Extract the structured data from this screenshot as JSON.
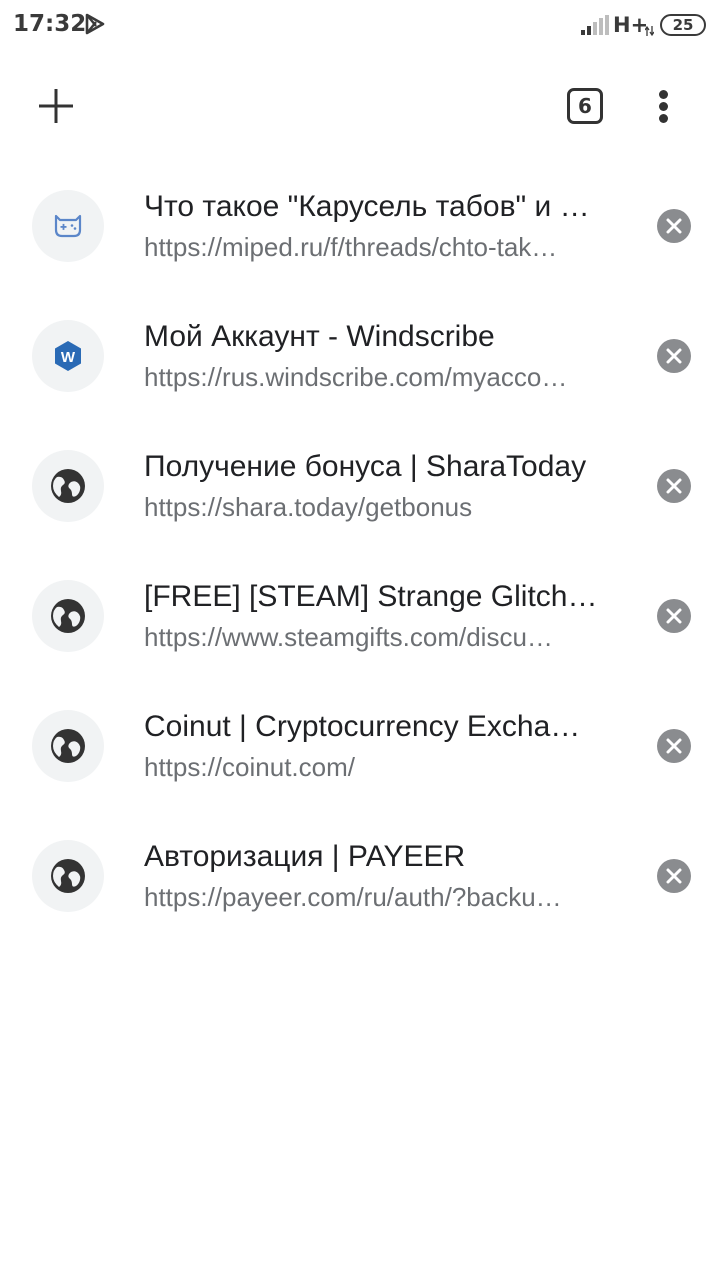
{
  "status_bar": {
    "time": "17:32",
    "app_icon": "play-store-icon",
    "network": "H+",
    "battery": "25"
  },
  "toolbar": {
    "new_tab_icon": "plus-icon",
    "tab_count": "6",
    "menu_icon": "more-vert-icon"
  },
  "tabs": [
    {
      "title": "Что такое \"Карусель табов\" и …",
      "url": "https://miped.ru/f/threads/chto-tak…",
      "favicon": "gamepad-icon"
    },
    {
      "title": "Мой Аккаунт - Windscribe",
      "url": "https://rus.windscribe.com/myacco…",
      "favicon": "windscribe-logo",
      "favicon_text": "W"
    },
    {
      "title": "Получение бонуса | SharaToday",
      "url": "https://shara.today/getbonus",
      "favicon": "globe-icon"
    },
    {
      "title": "[FREE] [STEAM] Strange Glitch…",
      "url": "https://www.steamgifts.com/discu…",
      "favicon": "globe-icon"
    },
    {
      "title": "Coinut | Cryptocurrency Excha…",
      "url": "https://coinut.com/",
      "favicon": "globe-icon"
    },
    {
      "title": "Авторизация | PAYEER",
      "url": "https://payeer.com/ru/auth/?backu…",
      "favicon": "globe-icon"
    }
  ],
  "colors": {
    "title_text": "#202124",
    "url_text": "#6c6f73",
    "favicon_bg": "#f1f3f4",
    "close_bg": "#8a8c8f",
    "windscribe_blue": "#2a6ab5"
  }
}
